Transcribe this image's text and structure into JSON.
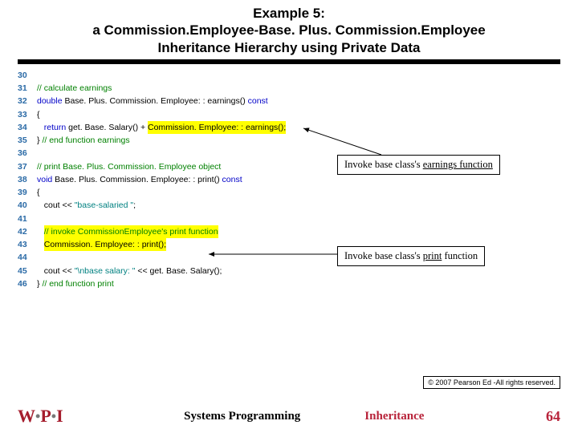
{
  "title": {
    "line1": "Example 5:",
    "line2": "a Commission.Employee-Base. Plus. Commission.Employee",
    "line3": "Inheritance Hierarchy using Private Data"
  },
  "code": {
    "lines": [
      {
        "n": "30",
        "segs": [
          {
            "t": "",
            "c": ""
          }
        ]
      },
      {
        "n": "31",
        "segs": [
          {
            "t": "// calculate earnings",
            "c": "cmt"
          }
        ]
      },
      {
        "n": "32",
        "segs": [
          {
            "t": "double",
            "c": "kw"
          },
          {
            "t": " Base. Plus. Commission. Employee: : earnings() ",
            "c": "cls"
          },
          {
            "t": "const",
            "c": "kw"
          }
        ]
      },
      {
        "n": "33",
        "segs": [
          {
            "t": "{",
            "c": ""
          }
        ]
      },
      {
        "n": "34",
        "segs": [
          {
            "t": "   ",
            "c": ""
          },
          {
            "t": "return",
            "c": "kw"
          },
          {
            "t": " get. Base. Salary() + ",
            "c": ""
          },
          {
            "t": "Commission. Employee: : earnings();",
            "c": "hl"
          }
        ]
      },
      {
        "n": "35",
        "segs": [
          {
            "t": "} ",
            "c": ""
          },
          {
            "t": "// end function earnings",
            "c": "cmt"
          }
        ]
      },
      {
        "n": "36",
        "segs": [
          {
            "t": "",
            "c": ""
          }
        ]
      },
      {
        "n": "37",
        "segs": [
          {
            "t": "// print Base. Plus. Commission. Employee object",
            "c": "cmt"
          }
        ]
      },
      {
        "n": "38",
        "segs": [
          {
            "t": "void",
            "c": "kw"
          },
          {
            "t": " Base. Plus. Commission. Employee: : print() ",
            "c": "cls"
          },
          {
            "t": "const",
            "c": "kw"
          }
        ]
      },
      {
        "n": "39",
        "segs": [
          {
            "t": "{",
            "c": ""
          }
        ]
      },
      {
        "n": "40",
        "segs": [
          {
            "t": "   cout << ",
            "c": ""
          },
          {
            "t": "\"base-salaried \"",
            "c": "str"
          },
          {
            "t": ";",
            "c": ""
          }
        ]
      },
      {
        "n": "41",
        "segs": [
          {
            "t": "",
            "c": ""
          }
        ]
      },
      {
        "n": "42",
        "segs": [
          {
            "t": "   ",
            "c": ""
          },
          {
            "t": "// invoke CommissionEmployee's print function",
            "c": "cmt hl"
          }
        ]
      },
      {
        "n": "43",
        "segs": [
          {
            "t": "   ",
            "c": ""
          },
          {
            "t": "Commission. Employee: : print();",
            "c": "hl"
          }
        ]
      },
      {
        "n": "44",
        "segs": [
          {
            "t": "",
            "c": ""
          }
        ]
      },
      {
        "n": "45",
        "segs": [
          {
            "t": "   cout << ",
            "c": ""
          },
          {
            "t": "\"\\nbase salary: \"",
            "c": "str"
          },
          {
            "t": " << get. Base. Salary();",
            "c": ""
          }
        ]
      },
      {
        "n": "46",
        "segs": [
          {
            "t": "} ",
            "c": ""
          },
          {
            "t": "// end function print",
            "c": "cmt"
          }
        ]
      }
    ]
  },
  "callouts": {
    "c1_pre": "Invoke base class's ",
    "c1_u": "earnings function",
    "c2_pre": "Invoke base class's ",
    "c2_u": "print",
    "c2_post": " function"
  },
  "copyright": "© 2007 Pearson Ed -All rights reserved.",
  "footer": {
    "left_logo": "WPI",
    "label1": "Systems Programming",
    "label2": "Inheritance",
    "page": "64"
  }
}
